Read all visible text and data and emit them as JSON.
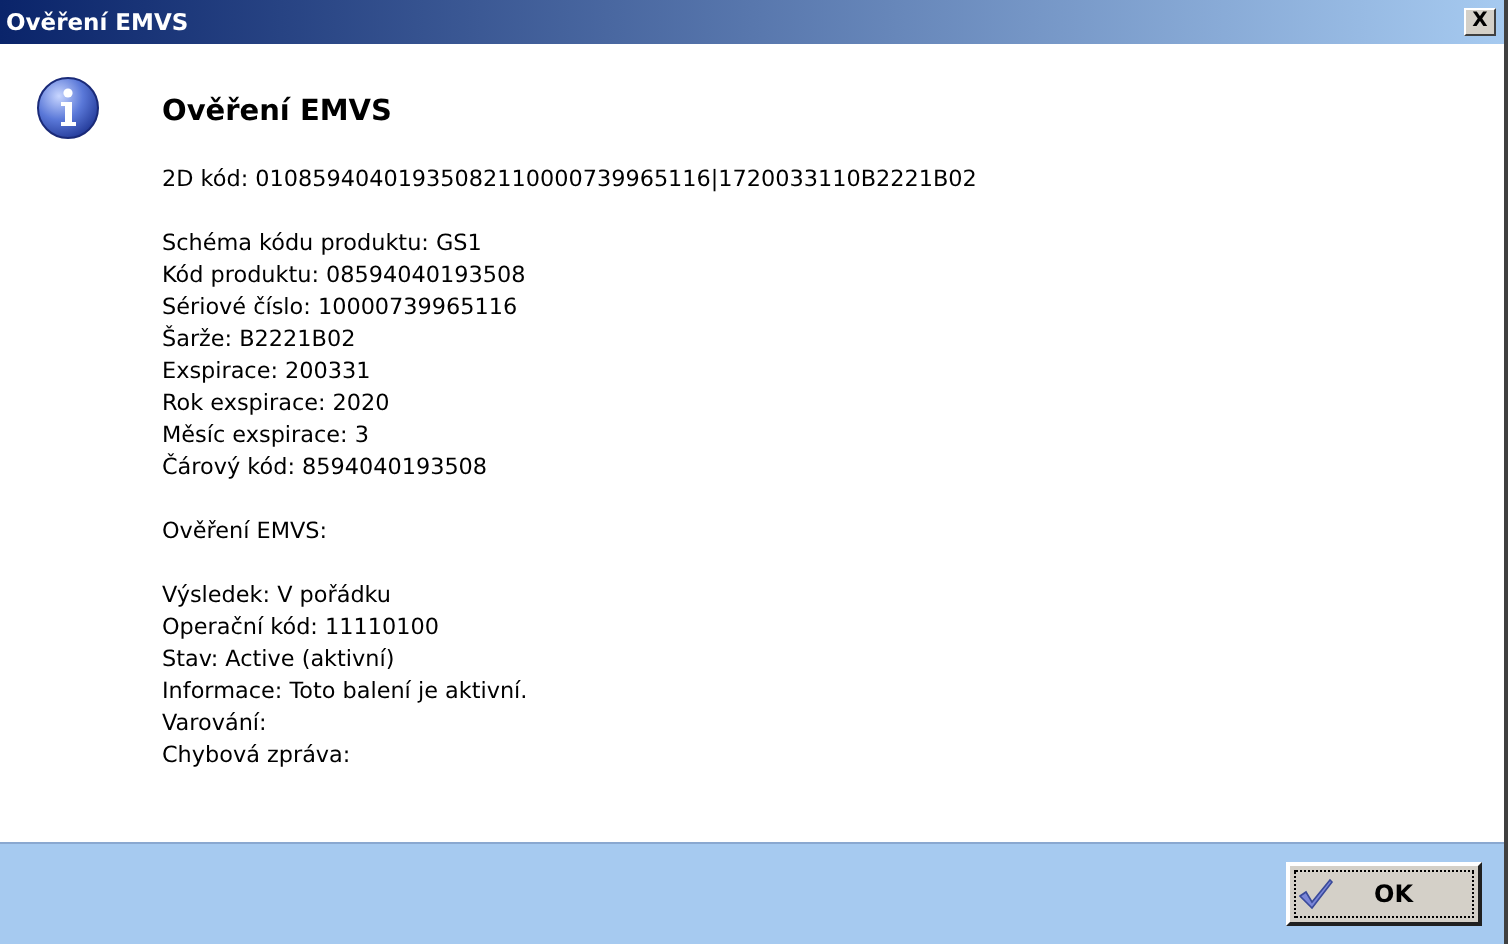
{
  "window": {
    "title": "Ověření EMVS",
    "close": "X"
  },
  "heading": "Ověření EMVS",
  "code_line": "2D kód: 01085940401935082110000739965116|1720033110B2221B02",
  "product_lines": [
    "Schéma kódu produktu: GS1",
    "Kód produktu: 08594040193508",
    "Sériové číslo: 10000739965116",
    "Šarže: B2221B02",
    "Exspirace: 200331",
    "Rok exspirace: 2020",
    "Měsíc exspirace: 3",
    "Čárový kód: 8594040193508"
  ],
  "verification_heading": "Ověření EMVS:",
  "result_lines": [
    "Výsledek: V pořádku",
    "Operační kód: 11110100",
    "Stav: Active (aktivní)",
    "Informace: Toto balení je aktivní.",
    "Varování:",
    "Chybová zpráva:"
  ],
  "buttons": [
    {
      "label": "OK"
    }
  ]
}
